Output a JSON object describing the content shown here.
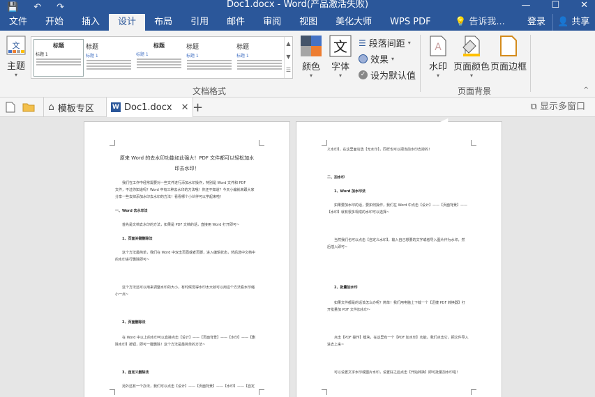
{
  "title_bar": {
    "title": "Doc1.docx - Word(产品激活失败)",
    "qat": [
      "💾",
      "↶",
      "↷"
    ],
    "window_buttons": [
      "—",
      "☐",
      "✕"
    ]
  },
  "menu": {
    "tabs": [
      "文件",
      "开始",
      "插入",
      "设计",
      "布局",
      "引用",
      "邮件",
      "审阅",
      "视图",
      "美化大师",
      "WPS PDF"
    ],
    "active_tab": "设计",
    "tell_me": "告诉我...",
    "login": "登录",
    "share": "共享"
  },
  "ribbon": {
    "theme_label": "主题",
    "gallery": [
      {
        "title": "标题",
        "sub": "标题 1"
      },
      {
        "title": "标题",
        "sub": "标题 1"
      },
      {
        "title": "标题",
        "sub": "标题 1"
      },
      {
        "title": "标题",
        "sub": "标题 1"
      },
      {
        "title": "标题",
        "sub": "标题 1"
      }
    ],
    "colors_label": "颜色",
    "fonts_label": "字体",
    "paragraph_spacing": "段落间距",
    "effects": "效果",
    "set_default": "设为默认值",
    "group_document_format": "文档格式",
    "watermark": "水印",
    "page_color": "页面颜色",
    "page_border": "页面边框",
    "group_page_background": "页面背景",
    "accent_color": "#2b579a"
  },
  "tabstrip": {
    "template_tab": "模板专区",
    "doc_tab": "Doc1.docx",
    "close": "✕",
    "add": "+",
    "multi_window": "显示多窗口"
  },
  "page1": {
    "title_line1": "原来 Word 的去水印功能如此强大！PDF 文件都可以轻松加水",
    "title_line2": "印去水印！",
    "lines": [
      "我们在工作中经常需要对一些文件进行添加水印操作，特别是 Word 文件和 PDF",
      "文件，不过你知道吗？Word 中有三种去水印的方法哦！你还不知道？今天小编就来跟大家",
      "分享一些去掉添加水印去水印的方法！看看哪个小伙伴可以学起来啦！",
      "一、Word 去水印法",
      "首先是文档去水印的方法，如果是 PDF 文档的话，直接用 Word 打开即可~",
      "1、页面关键删除法",
      "这个方法最简单，我们在 Word 中双击页眉或者页脚，进入编辑状态，然后选中文档中",
      "的水印进行删除即可~",
      "这个方法还可以用来调整水印的大小，有时候觉得水印太大就可以用这个方法看水印缩",
      "小一点~",
      "2、页面删除法",
      "在 Word 中以上的水印可以直接点击【设计】——【页面背景】——【水印】——【删",
      "除水印】按钮，即可一键删除！这个方法是最简单的方法~",
      "3、自定义删除法",
      "另外还有一个办法，我们可以点击【设计】——【页面背景】——【水印】——【自定"
    ]
  },
  "page2": {
    "lines": [
      "义水印】，在这里面勾选【无水印】，同样也可以把当前水印去掉的！",
      "二、加水印",
      "1、Word 加水印法",
      "如果要加水印的话，要如何操作，我们在 Word 中点击【设计】——【页面背景】——",
      "【水印】就有很多现成的水印可以选择~",
      "当然我们也可以点击【自定义水印】，输入自己想要的文字或者导入图片作为水印，然",
      "后插入即可~",
      "2、批量加水印",
      "如果文件都是的话该怎么办呢？简单！我们用电脑上下载一个【迅捷 PDF 转换器】打",
      "开批量加 PDF 文件加水印~",
      "点击【PDF 操作】模块，在这里有一个【PDF 加水印】功能，我们点击它，把文件导入",
      "进去上来~",
      "可以设置文字水印或图片水印，设置好之后点击【开始转换】即可批量加水印啦！"
    ]
  }
}
